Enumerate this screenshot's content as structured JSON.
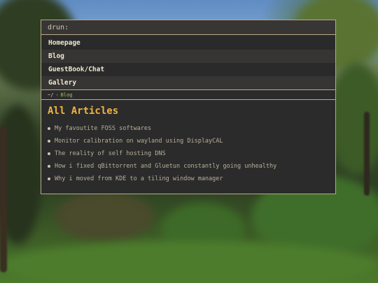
{
  "launcher": {
    "prompt": "drun:",
    "input_value": "",
    "items": [
      {
        "label": "Homepage"
      },
      {
        "label": "Blog"
      },
      {
        "label": "GuestBook/Chat"
      },
      {
        "label": "Gallery"
      }
    ]
  },
  "breadcrumb": {
    "home": "~/",
    "separator": "›",
    "current": "Blog"
  },
  "main": {
    "heading": "All Articles",
    "articles": [
      {
        "title": "My favoutite FOSS softwares"
      },
      {
        "title": "Monitor calibration on wayland using DisplayCAL"
      },
      {
        "title": "The reality of self hosting DNS"
      },
      {
        "title": "How i fixed qBittorrent and Gluetun constantly going unhealthy"
      },
      {
        "title": "Why i moved from KDE to a tiling window manager"
      }
    ]
  },
  "colors": {
    "accent": "#f2b33d",
    "border": "#b9a98a",
    "breadcrumb_current": "#9bc45c",
    "background": "#2b2b2b"
  }
}
